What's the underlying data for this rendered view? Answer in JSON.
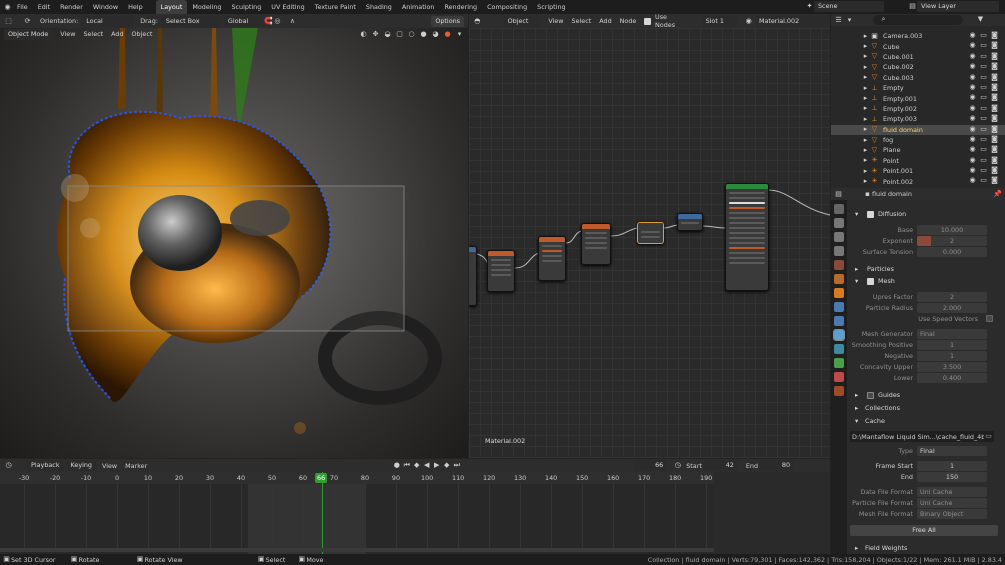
{
  "menu": {
    "items": [
      "File",
      "Edit",
      "Render",
      "Window",
      "Help"
    ],
    "workspaces": [
      "Layout",
      "Modeling",
      "Sculpting",
      "UV Editing",
      "Texture Paint",
      "Shading",
      "Animation",
      "Rendering",
      "Compositing",
      "Scripting"
    ],
    "active_workspace": "Layout",
    "scene": "Scene",
    "view_layer": "View Layer"
  },
  "viewport_header": {
    "orientation_label": "Orientation:",
    "orientation_value": "Local",
    "drag_label": "Drag:",
    "drag_value": "Select Box",
    "transform_pivot": "Global",
    "options": "Options"
  },
  "viewport_toolbar": {
    "mode": "Object Mode",
    "menus": [
      "View",
      "Select",
      "Add",
      "Object"
    ]
  },
  "node_header": {
    "type": "Object",
    "menus": [
      "View",
      "Select",
      "Add",
      "Node"
    ],
    "use_nodes": "Use Nodes",
    "slot": "Slot 1",
    "material": "Material.002"
  },
  "node_editor": {
    "material_label": "Material.002"
  },
  "timeline_header": {
    "playback": "Playback",
    "keying": "Keying",
    "view": "View",
    "marker": "Marker",
    "current_frame": "66",
    "start_label": "Start",
    "start": "42",
    "end_label": "End",
    "end": "80"
  },
  "timeline": {
    "ticks": [
      "-30",
      "-20",
      "-10",
      "0",
      "10",
      "20",
      "30",
      "40",
      "50",
      "60",
      "70",
      "80",
      "90",
      "100",
      "110",
      "120",
      "130",
      "140",
      "150",
      "160",
      "170",
      "180",
      "190"
    ],
    "playhead": "66"
  },
  "statusbar": {
    "left": [
      "Set 3D Cursor",
      "Rotate",
      "Rotate View",
      "Select",
      "Move"
    ],
    "stats": "Collection | fluid domain | Verts:79,301 | Faces:142,362 | Tris:158,204 | Objects:1/22 | Mem: 261.1 MiB | 2.83.4"
  },
  "outliner": {
    "items": [
      {
        "name": "Camera.003",
        "selected": false
      },
      {
        "name": "Cube",
        "selected": false
      },
      {
        "name": "Cube.001",
        "selected": false
      },
      {
        "name": "Cube.002",
        "selected": false
      },
      {
        "name": "Cube.003",
        "selected": false
      },
      {
        "name": "Empty",
        "selected": false
      },
      {
        "name": "Empty.001",
        "selected": false
      },
      {
        "name": "Empty.002",
        "selected": false
      },
      {
        "name": "Empty.003",
        "selected": false
      },
      {
        "name": "fluid domain",
        "selected": true
      },
      {
        "name": "fog",
        "selected": false
      },
      {
        "name": "Plane",
        "selected": false
      },
      {
        "name": "Point",
        "selected": false
      },
      {
        "name": "Point.001",
        "selected": false
      },
      {
        "name": "Point.002",
        "selected": false
      }
    ]
  },
  "properties": {
    "object_name": "fluid domain",
    "diffusion": {
      "title": "Diffusion",
      "base_label": "Base",
      "base_value": "10.000",
      "exponent_label": "Exponent",
      "exponent_value": "2",
      "surface_tension_label": "Surface Tension",
      "surface_tension_value": "0.000"
    },
    "particles": "Particles",
    "mesh": {
      "title": "Mesh",
      "upres_label": "Upres Factor",
      "upres_value": "2",
      "particle_radius_label": "Particle Radius",
      "particle_radius_value": "2.000",
      "use_speed_vectors": "Use Speed Vectors",
      "mesh_generator_label": "Mesh Generator",
      "mesh_generator_value": "Final",
      "smoothing_positive_label": "Smoothing Positive",
      "smoothing_positive_value": "1",
      "negative_label": "Negative",
      "negative_value": "1",
      "concavity_upper_label": "Concavity Upper",
      "concavity_upper_value": "3.500",
      "lower_label": "Lower",
      "lower_value": "0.400"
    },
    "guides": "Guides",
    "collections": "Collections",
    "cache": {
      "title": "Cache",
      "path": "D:\\Mantaflow Liquid Sim...\\cache_fluid_4b85f272",
      "type_label": "Type",
      "type_value": "Final",
      "frame_start_label": "Frame Start",
      "frame_start_value": "1",
      "end_label": "End",
      "end_value": "150",
      "data_format_label": "Data File Format",
      "data_format_value": "Uni Cache",
      "particle_format_label": "Particle File Format",
      "particle_format_value": "Uni Cache",
      "mesh_format_label": "Mesh File Format",
      "mesh_format_value": "Binary Object",
      "free_all": "Free All"
    },
    "field_weights": "Field Weights"
  },
  "colors": {
    "accent": "#4772b3",
    "playhead": "#2f9f2f",
    "selected_text": "#ffd27a",
    "exponent_bar": "#8c4a3a"
  }
}
